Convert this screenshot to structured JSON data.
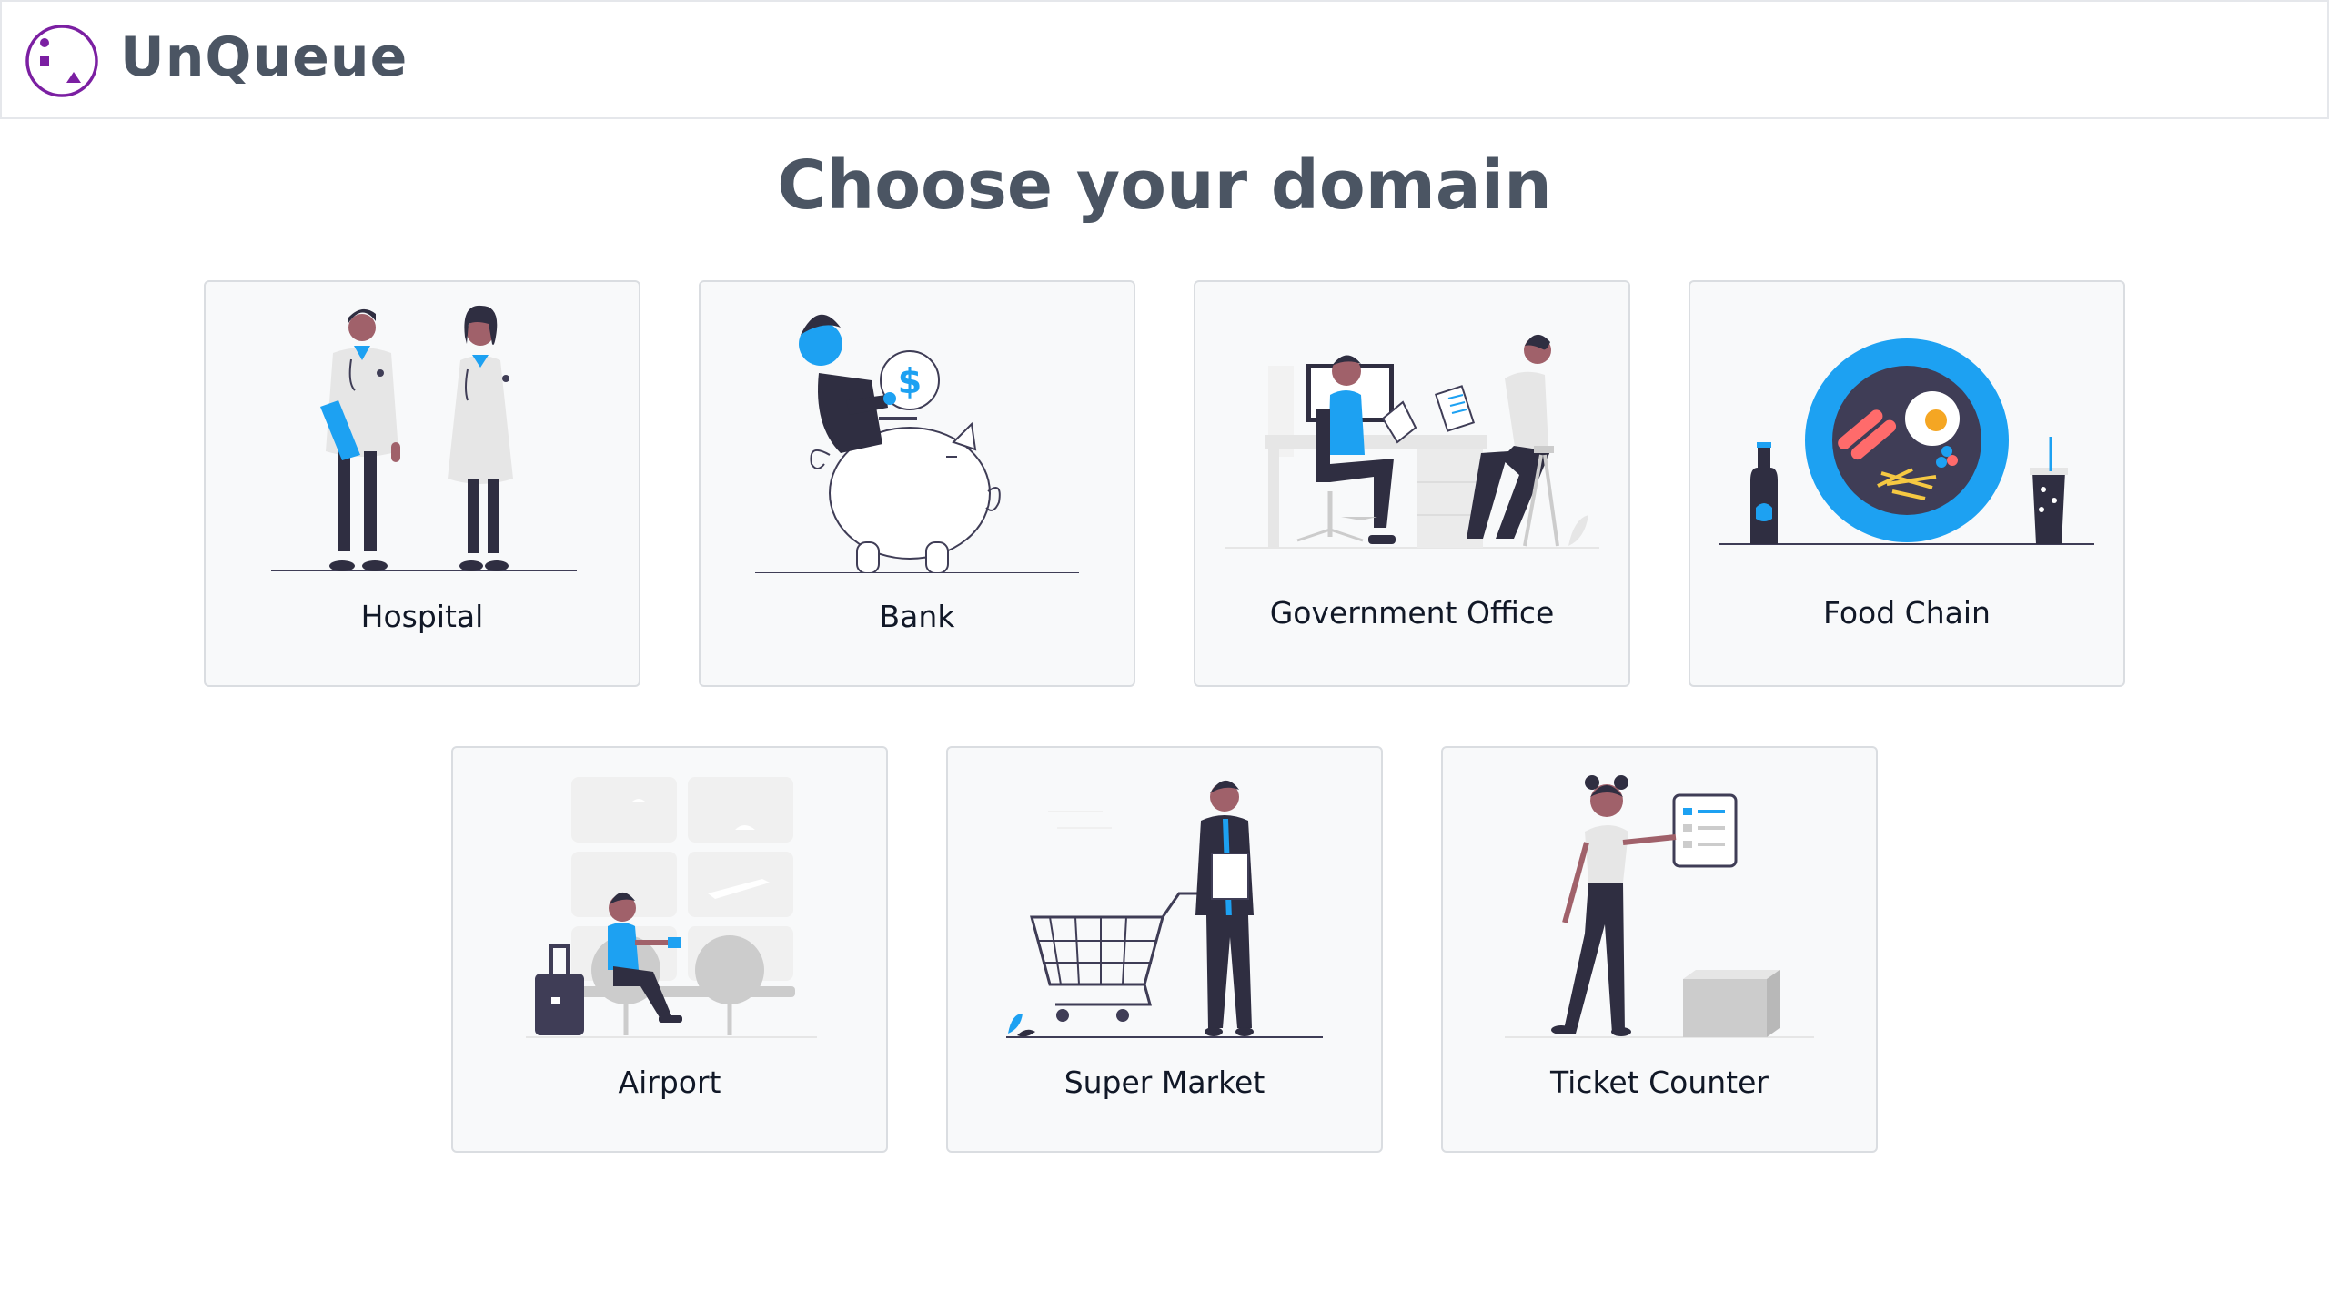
{
  "header": {
    "brand": "UnQueue",
    "logo_icon": "unqueue-logo-icon"
  },
  "page": {
    "title": "Choose your domain"
  },
  "colors": {
    "accent": "#1da1f2",
    "brand": "#7b1fa2",
    "text": "#4b5563",
    "dark": "#2f2e41"
  },
  "domains": [
    {
      "label": "Hospital",
      "icon": "hospital-illustration"
    },
    {
      "label": "Bank",
      "icon": "bank-illustration"
    },
    {
      "label": "Government Office",
      "icon": "government-office-illustration"
    },
    {
      "label": "Food Chain",
      "icon": "food-chain-illustration"
    },
    {
      "label": "Airport",
      "icon": "airport-illustration"
    },
    {
      "label": "Super Market",
      "icon": "super-market-illustration"
    },
    {
      "label": "Ticket Counter",
      "icon": "ticket-counter-illustration"
    }
  ]
}
